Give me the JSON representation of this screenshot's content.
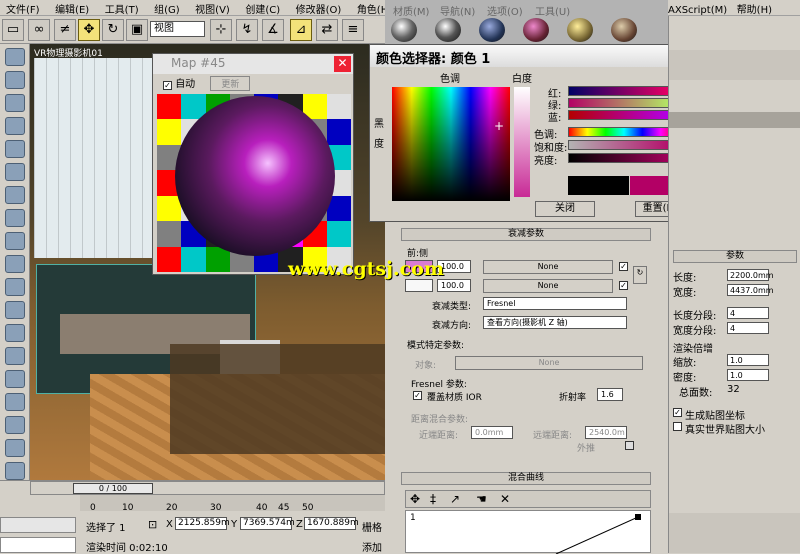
{
  "menu": [
    "文件(F)",
    "编辑(E)",
    "工具(T)",
    "组(G)",
    "视图(V)",
    "创建(C)",
    "修改器(O)",
    "角色(H)",
    "AXScript(M)",
    "帮助(H)"
  ],
  "toolbar": {
    "view_select": "视图",
    "view_select_right": "视图"
  },
  "viewport": {
    "label": "VR物理摄影机01"
  },
  "map_dialog": {
    "title": "Map #45",
    "auto_label": "自动",
    "update_label": "更新"
  },
  "mat_editor_menu": [
    "材质(M)",
    "导航(N)",
    "选项(O)",
    "工具(U)"
  ],
  "color_dialog": {
    "title": "颜色选择器: 颜色 1",
    "hue_label": "色调",
    "whiteness_label": "白度",
    "blackness_label": "黑度",
    "rows": [
      {
        "label": "红:",
        "value": "179"
      },
      {
        "label": "绿:",
        "value": "0"
      },
      {
        "label": "蓝:",
        "value": "101"
      },
      {
        "label": "色调:",
        "value": "231"
      },
      {
        "label": "饱和度:",
        "value": "255"
      },
      {
        "label": "亮度:",
        "value": "179"
      }
    ],
    "close_label": "关闭",
    "reset_label": "重置(R)",
    "colors": {
      "old": "#000000",
      "new": "#b30065"
    }
  },
  "falloff": {
    "rollout": "衰减参数",
    "front_side": "前:侧",
    "v1": "100.0",
    "v2": "100.0",
    "none1": "None",
    "none2": "None",
    "type_label": "衰减类型:",
    "type_value": "Fresnel",
    "dir_label": "衰减方向:",
    "dir_value": "查看方向(摄影机 Z 轴)",
    "mode_group": "模式特定参数:",
    "object_label": "对象:",
    "object_value": "None",
    "fresnel_group": "Fresnel 参数:",
    "override_ior": "覆盖材质 IOR",
    "ior_label": "折射率",
    "ior_value": "1.6",
    "dist_group": "距离混合参数:",
    "near_label": "近端距离:",
    "near_value": "0.0mm",
    "far_label": "远端距离:",
    "far_value": "2540.0m",
    "extrap_label": "外推",
    "mix_rollout": "混合曲线",
    "curve_label": "1"
  },
  "right_panel": {
    "params_rollout": "参数",
    "length_label": "长度:",
    "length_value": "2200.0mm",
    "width_label": "宽度:",
    "width_value": "4437.0mm",
    "lsegs_label": "长度分段:",
    "lsegs_value": "4",
    "wsegs_label": "宽度分段:",
    "wsegs_value": "4",
    "render_mult": "渲染倍增",
    "scale_label": "缩放:",
    "scale_value": "1.0",
    "density_label": "密度:",
    "density_value": "1.0",
    "faces_label": "总面数:",
    "faces_value": "32",
    "gen_coords": "生成贴图坐标",
    "real_world": "真实世界贴图大小"
  },
  "status": {
    "timeline": "0 / 100",
    "ticks": [
      "0",
      "10",
      "20",
      "30",
      "40",
      "45",
      "50"
    ],
    "selected": "选择了 1",
    "x_value": "2125.859m",
    "y_value": "7369.574m",
    "z_value": "1670.889m",
    "grid_label": "栅格",
    "render_time": "渲染时间  0:02:10",
    "add_label": "添加"
  },
  "watermark": "www.cgtsj.com"
}
